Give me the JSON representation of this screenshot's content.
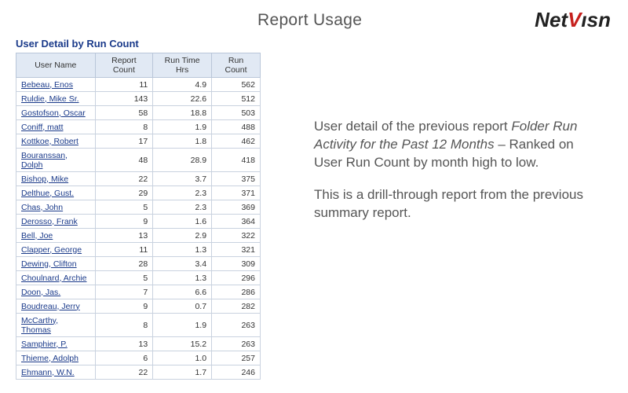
{
  "page_title": "Report Usage",
  "logo": {
    "part1": "Net",
    "part2": "V",
    "part3": "ısn"
  },
  "report": {
    "title": "User Detail by Run Count",
    "columns": [
      "User Name",
      "Report Count",
      "Run Time Hrs",
      "Run Count"
    ],
    "rows": [
      {
        "name": "Bebeau, Enos",
        "report_count": "11",
        "run_time": "4.9",
        "run_count": "562"
      },
      {
        "name": "Ruldie, Mike Sr.",
        "report_count": "143",
        "run_time": "22.6",
        "run_count": "512"
      },
      {
        "name": "Gostofson, Oscar",
        "report_count": "58",
        "run_time": "18.8",
        "run_count": "503"
      },
      {
        "name": "Coniff, matt",
        "report_count": "8",
        "run_time": "1.9",
        "run_count": "488"
      },
      {
        "name": "Kottkoe, Robert",
        "report_count": "17",
        "run_time": "1.8",
        "run_count": "462"
      },
      {
        "name": "Bouranssan, Dolph",
        "report_count": "48",
        "run_time": "28.9",
        "run_count": "418"
      },
      {
        "name": "Bishop, Mike",
        "report_count": "22",
        "run_time": "3.7",
        "run_count": "375"
      },
      {
        "name": "Delthue, Gust.",
        "report_count": "29",
        "run_time": "2.3",
        "run_count": "371"
      },
      {
        "name": "Chas, John",
        "report_count": "5",
        "run_time": "2.3",
        "run_count": "369"
      },
      {
        "name": "Derosso, Frank",
        "report_count": "9",
        "run_time": "1.6",
        "run_count": "364"
      },
      {
        "name": "Bell, Joe",
        "report_count": "13",
        "run_time": "2.9",
        "run_count": "322"
      },
      {
        "name": "Clapper, George",
        "report_count": "11",
        "run_time": "1.3",
        "run_count": "321"
      },
      {
        "name": "Dewing, Clifton",
        "report_count": "28",
        "run_time": "3.4",
        "run_count": "309"
      },
      {
        "name": "Choulnard, Archie",
        "report_count": "5",
        "run_time": "1.3",
        "run_count": "296"
      },
      {
        "name": "Doon, Jas.",
        "report_count": "7",
        "run_time": "6.6",
        "run_count": "286"
      },
      {
        "name": "Boudreau, Jerry",
        "report_count": "9",
        "run_time": "0.7",
        "run_count": "282"
      },
      {
        "name": "McCarthy, Thomas",
        "report_count": "8",
        "run_time": "1.9",
        "run_count": "263"
      },
      {
        "name": "Samphier, P.",
        "report_count": "13",
        "run_time": "15.2",
        "run_count": "263"
      },
      {
        "name": "Thieme, Adolph",
        "report_count": "6",
        "run_time": "1.0",
        "run_count": "257"
      },
      {
        "name": "Ehmann, W.N.",
        "report_count": "22",
        "run_time": "1.7",
        "run_count": "246"
      }
    ]
  },
  "description": {
    "p1_prefix": "User detail of the previous report ",
    "p1_italic": "Folder Run Activity for the Past 12 Months",
    "p1_suffix": " – Ranked on User Run Count by month high to low.",
    "p2": "This is a drill-through report from the previous summary report."
  }
}
